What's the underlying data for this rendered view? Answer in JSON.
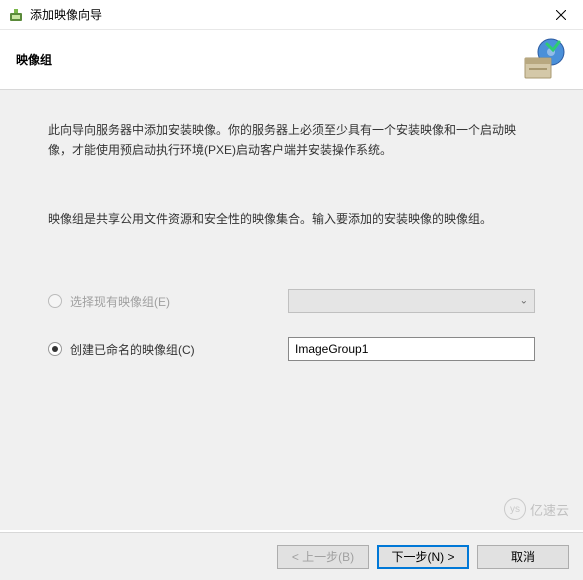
{
  "titlebar": {
    "title": "添加映像向导"
  },
  "header": {
    "title": "映像组"
  },
  "content": {
    "intro": "此向导向服务器中添加安装映像。你的服务器上必须至少具有一个安装映像和一个启动映像，才能使用预启动执行环境(PXE)启动客户端并安装操作系统。",
    "description": "映像组是共享公用文件资源和安全性的映像集合。输入要添加的安装映像的映像组。",
    "option_existing": "选择现有映像组(E)",
    "option_create": "创建已命名的映像组(C)",
    "group_name": "ImageGroup1"
  },
  "buttons": {
    "back": "< 上一步(B)",
    "next": "下一步(N) >",
    "cancel": "取消"
  },
  "watermark": {
    "text": "亿速云"
  }
}
